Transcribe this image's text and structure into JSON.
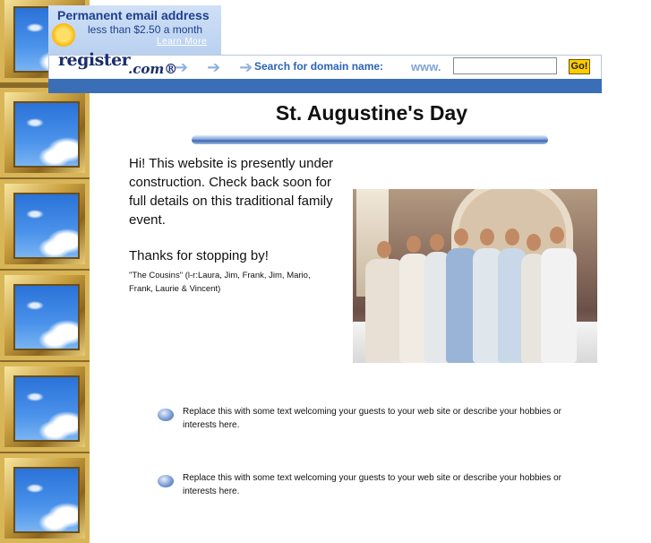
{
  "ad": {
    "title": "Permanent email address",
    "subtitle": "less than $2.50 a month",
    "learn_more": "Learn More"
  },
  "registrar_bar": {
    "logo_main": "register",
    "logo_com": ".com®",
    "arrows": "➔ ➔ ➔",
    "search_label": "Search for domain name:",
    "www": "www.",
    "input_value": "",
    "go_label": "Go!"
  },
  "page": {
    "title": "St. Augustine's Day",
    "intro": "Hi! This website is presently under construction. Check back soon for full details on this traditional family event.",
    "thanks": "Thanks for stopping by!",
    "caption": "\"The Cousins\" (l-r:Laura, Jim, Frank, Jim, Mario, Frank, Laurie & Vincent)"
  },
  "bullets": [
    {
      "text": "Replace this with some text welcoming your guests to your web site or describe your hobbies or interests here."
    },
    {
      "text": "Replace this with some text welcoming your guests to your web site or describe your hobbies or interests here."
    }
  ]
}
